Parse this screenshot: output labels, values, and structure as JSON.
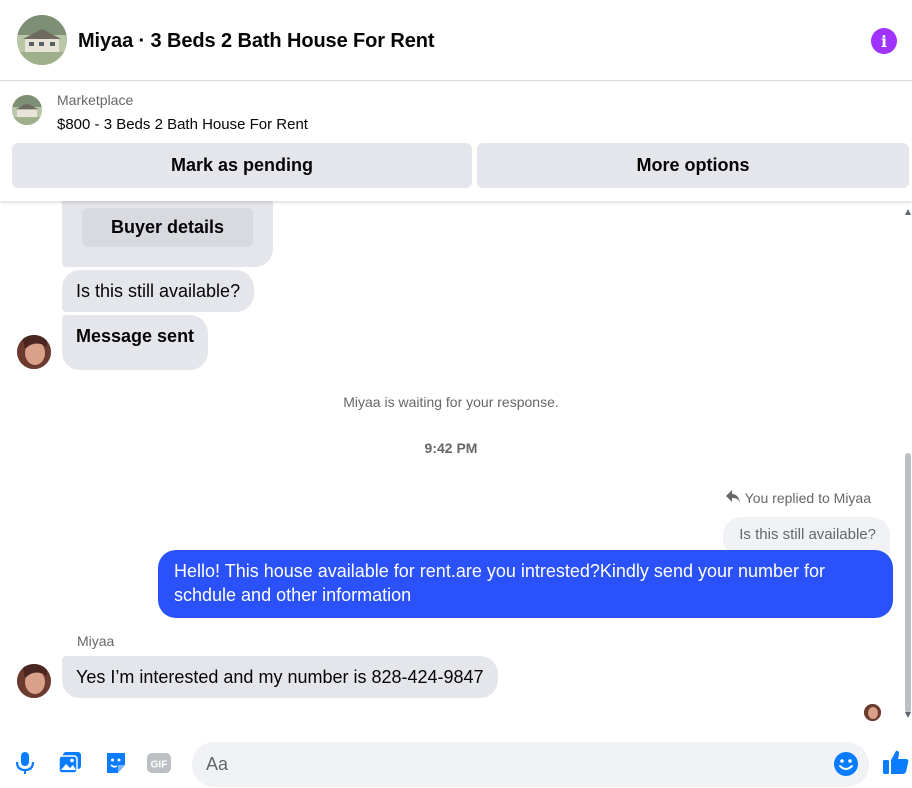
{
  "header": {
    "title": "Miyaa · 3 Beds 2 Bath House For Rent",
    "info_icon": "info-icon",
    "accent_color": "#a033ff"
  },
  "marketplace": {
    "label": "Marketplace",
    "item": "$800 - 3 Beds 2 Bath House For Rent",
    "mark_pending_label": "Mark as pending",
    "more_options_label": "More options"
  },
  "messages": {
    "buyer_details_label": "Buyer details",
    "incoming_1": "Is this still available?",
    "incoming_2": "Message sent",
    "waiting_note": "Miyaa is waiting for your response.",
    "timestamp": "9:42 PM",
    "replied_note": "You replied to Miyaa",
    "quoted_text": "Is this still available?",
    "outgoing": "Hello! This house available for rent.are you intrested?Kindly send your number for schdule and other information",
    "sender_name": "Miyaa",
    "incoming_3": "Yes I’m interested and my number is 828-424-9847",
    "outgoing_color": "#2a51fa"
  },
  "composer": {
    "placeholder": "Aa",
    "icons": [
      "microphone-icon",
      "photo-icon",
      "sticker-icon",
      "gif-icon",
      "emoji-icon",
      "thumbs-up-icon"
    ],
    "icon_color": "#0a7cff"
  }
}
